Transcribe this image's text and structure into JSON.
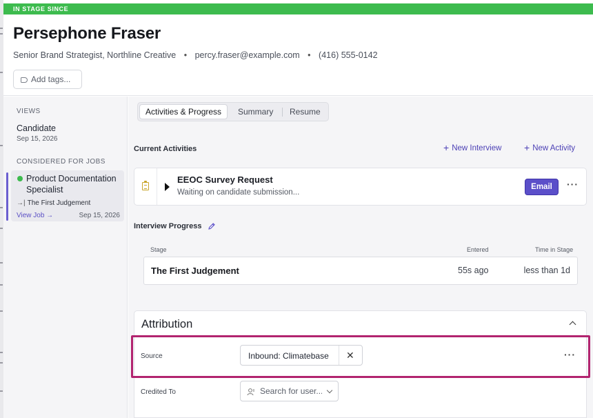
{
  "banner": {
    "label": "IN STAGE SINCE"
  },
  "candidate": {
    "name": "Persephone Fraser",
    "title_company": "Senior Brand Strategist, Northline Creative",
    "email": "percy.fraser@example.com",
    "phone": "(416) 555-0142",
    "separator": "•",
    "add_tags_label": "Add tags..."
  },
  "sidebar": {
    "views_heading": "VIEWS",
    "view_title": "Candidate",
    "view_date": "Sep 15, 2026",
    "jobs_heading": "CONSIDERED FOR JOBS",
    "job": {
      "title": "Product Documentation Specialist",
      "stage": "The First Judgement",
      "stage_glyph": "→|",
      "view_link": "View Job →",
      "date": "Sep 15, 2026"
    }
  },
  "tabs": [
    {
      "label": "Activities & Progress",
      "active": true
    },
    {
      "label": "Summary",
      "active": false
    },
    {
      "label": "Resume",
      "active": false
    }
  ],
  "activities": {
    "heading": "Current Activities",
    "new_interview": "New Interview",
    "new_activity": "New Activity",
    "plus": "+",
    "item": {
      "title": "EEOC Survey Request",
      "subtitle": "Waiting on candidate submission...",
      "email_label": "Email",
      "more": "···"
    }
  },
  "interview_progress": {
    "heading": "Interview Progress",
    "col_stage": "Stage",
    "col_entered": "Entered",
    "col_time": "Time in Stage",
    "row": {
      "stage": "The First Judgement",
      "entered": "55s ago",
      "time": "less than 1d"
    }
  },
  "attribution": {
    "title": "Attribution",
    "source_label": "Source",
    "source_value": "Inbound: Climatebase",
    "remove_glyph": "✕",
    "more": "···",
    "credited_label": "Credited To",
    "credited_placeholder": "Search for user..."
  },
  "colors": {
    "stage_green": "#3dbb4e",
    "accent_purple": "#5b4fc9",
    "highlight_magenta": "#b2246f"
  }
}
